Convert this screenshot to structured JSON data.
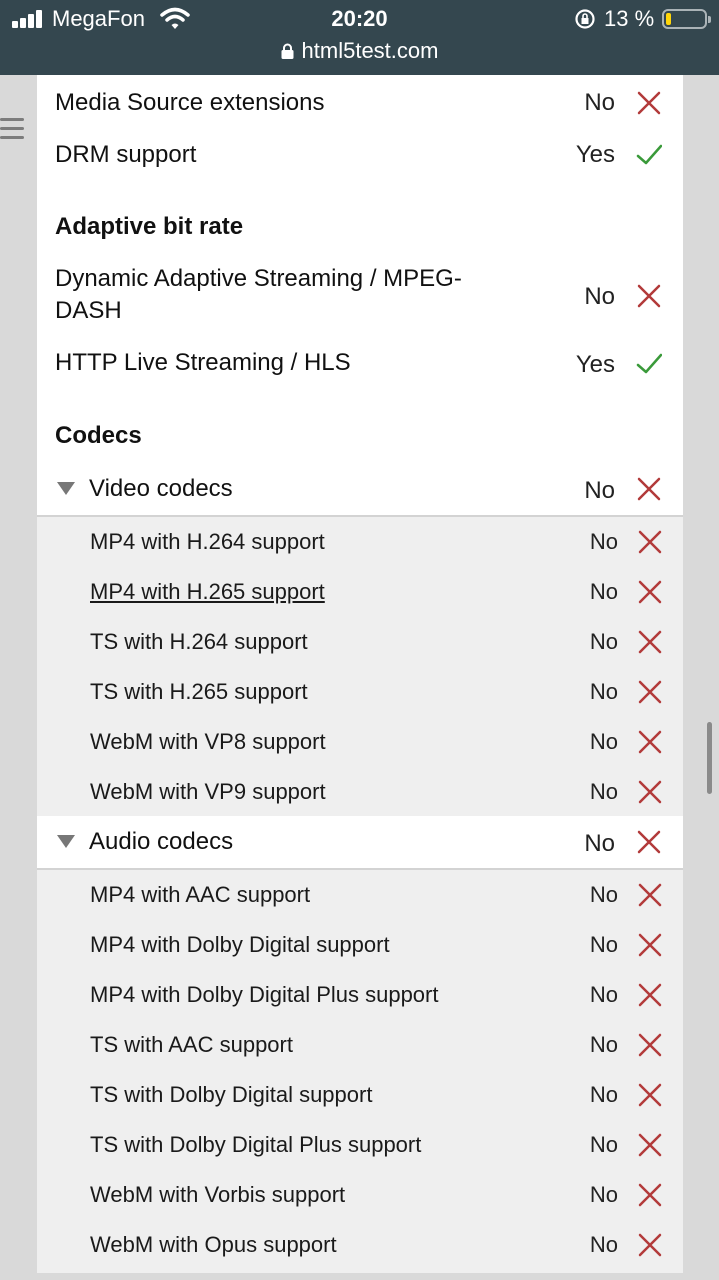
{
  "status_bar": {
    "carrier": "MegaFon",
    "time": "20:20",
    "battery": "13 %",
    "url": "html5test.com",
    "signal_icon": "signal-icon",
    "wifi_icon": "wifi-icon",
    "orientation_lock_icon": "orientation-lock-icon",
    "battery_icon": "battery-icon",
    "battery_level": 0.13
  },
  "colors": {
    "fail": "#b23a3a",
    "pass": "#3a9a3a",
    "topbar": "#34474f"
  },
  "features": {
    "mse": {
      "label": "Media Source extensions",
      "value": "No"
    },
    "drm": {
      "label": "DRM support",
      "value": "Yes"
    }
  },
  "adaptive": {
    "heading": "Adaptive bit rate",
    "dash": {
      "label": "Dynamic Adaptive Streaming / MPEG-DASH",
      "value": "No"
    },
    "hls": {
      "label": "HTTP Live Streaming / HLS",
      "value": "Yes"
    }
  },
  "codecs": {
    "heading": "Codecs",
    "video": {
      "label": "Video codecs",
      "value": "No",
      "items": [
        {
          "label": "MP4 with H.264 support",
          "value": "No"
        },
        {
          "label": "MP4 with H.265 support",
          "value": "No"
        },
        {
          "label": "TS with H.264 support",
          "value": "No"
        },
        {
          "label": "TS with H.265 support",
          "value": "No"
        },
        {
          "label": "WebM with VP8 support",
          "value": "No"
        },
        {
          "label": "WebM with VP9 support",
          "value": "No"
        }
      ]
    },
    "audio": {
      "label": "Audio codecs",
      "value": "No",
      "items": [
        {
          "label": "MP4 with AAC support",
          "value": "No"
        },
        {
          "label": "MP4 with Dolby Digital support",
          "value": "No"
        },
        {
          "label": "MP4 with Dolby Digital Plus support",
          "value": "No"
        },
        {
          "label": "TS with AAC support",
          "value": "No"
        },
        {
          "label": "TS with Dolby Digital support",
          "value": "No"
        },
        {
          "label": "TS with Dolby Digital Plus support",
          "value": "No"
        },
        {
          "label": "WebM with Vorbis support",
          "value": "No"
        },
        {
          "label": "WebM with Opus support",
          "value": "No"
        }
      ]
    }
  }
}
